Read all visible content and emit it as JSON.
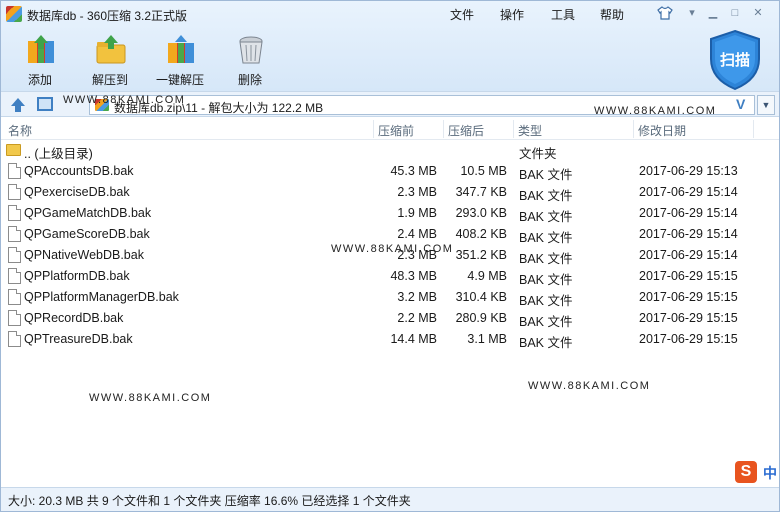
{
  "window": {
    "title": "数据库db - 360压缩 3.2正式版"
  },
  "menu": [
    "文件",
    "操作",
    "工具",
    "帮助"
  ],
  "toolbar": {
    "add": "添加",
    "extract_to": "解压到",
    "one_click_extract": "一键解压",
    "delete": "删除",
    "scan": "扫描"
  },
  "address": {
    "path": "数据库db.zip\\11 - 解包大小为 122.2 MB",
    "suffix": "V"
  },
  "columns": {
    "name": "名称",
    "compressed": "压缩前",
    "after": "压缩后",
    "type": "类型",
    "modified": "修改日期"
  },
  "parent_row": {
    "name": ".. (上级目录)",
    "type": "文件夹"
  },
  "files": [
    {
      "name": "QPAccountsDB.bak",
      "before": "45.3 MB",
      "after": "10.5 MB",
      "type": "BAK 文件",
      "date": "2017-06-29 15:13"
    },
    {
      "name": "QPexerciseDB.bak",
      "before": "2.3 MB",
      "after": "347.7 KB",
      "type": "BAK 文件",
      "date": "2017-06-29 15:14"
    },
    {
      "name": "QPGameMatchDB.bak",
      "before": "1.9 MB",
      "after": "293.0 KB",
      "type": "BAK 文件",
      "date": "2017-06-29 15:14"
    },
    {
      "name": "QPGameScoreDB.bak",
      "before": "2.4 MB",
      "after": "408.2 KB",
      "type": "BAK 文件",
      "date": "2017-06-29 15:14"
    },
    {
      "name": "QPNativeWebDB.bak",
      "before": "2.3 MB",
      "after": "351.2 KB",
      "type": "BAK 文件",
      "date": "2017-06-29 15:14"
    },
    {
      "name": "QPPlatformDB.bak",
      "before": "48.3 MB",
      "after": "4.9 MB",
      "type": "BAK 文件",
      "date": "2017-06-29 15:15"
    },
    {
      "name": "QPPlatformManagerDB.bak",
      "before": "3.2 MB",
      "after": "310.4 KB",
      "type": "BAK 文件",
      "date": "2017-06-29 15:15"
    },
    {
      "name": "QPRecordDB.bak",
      "before": "2.2 MB",
      "after": "280.9 KB",
      "type": "BAK 文件",
      "date": "2017-06-29 15:15"
    },
    {
      "name": "QPTreasureDB.bak",
      "before": "14.4 MB",
      "after": "3.1 MB",
      "type": "BAK 文件",
      "date": "2017-06-29 15:15"
    }
  ],
  "watermark": "WWW.88KAMI.COM",
  "status": "大小: 20.3 MB 共 9 个文件和 1 个文件夹 压缩率 16.6% 已经选择 1 个文件夹",
  "ime": {
    "logo": "S",
    "mode": "中"
  }
}
